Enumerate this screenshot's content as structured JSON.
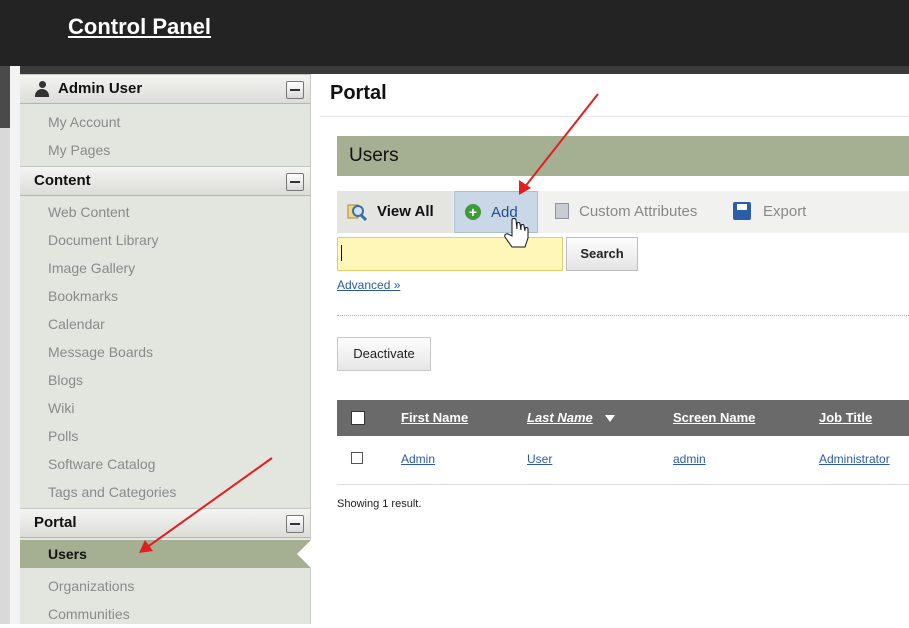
{
  "header": {
    "title": "Control Panel"
  },
  "sidebar": {
    "user_section": {
      "label": "Admin User",
      "items": [
        "My Account",
        "My Pages"
      ]
    },
    "content_section": {
      "label": "Content",
      "items": [
        "Web Content",
        "Document Library",
        "Image Gallery",
        "Bookmarks",
        "Calendar",
        "Message Boards",
        "Blogs",
        "Wiki",
        "Polls",
        "Software Catalog",
        "Tags and Categories"
      ]
    },
    "portal_section": {
      "label": "Portal",
      "items": [
        "Users",
        "Organizations",
        "Communities"
      ],
      "active_item": "Users"
    }
  },
  "main": {
    "page_title": "Portal",
    "panel_title": "Users",
    "toolbar": {
      "view_all": "View All",
      "add": "Add",
      "custom_attributes": "Custom Attributes",
      "export": "Export"
    },
    "search": {
      "value": "",
      "button": "Search",
      "advanced_link": "Advanced »"
    },
    "deactivate_button": "Deactivate",
    "table": {
      "columns": [
        "First Name",
        "Last Name",
        "Screen Name",
        "Job Title"
      ],
      "sorted_column": "Last Name",
      "rows": [
        {
          "first_name": "Admin",
          "last_name": "User",
          "screen_name": "admin",
          "job_title": "Administrator"
        }
      ]
    },
    "result_count": "Showing 1 result."
  },
  "colors": {
    "accent_green": "#a5b092",
    "top_bar": "#232323",
    "sidebar_bg": "#e3e5df",
    "search_highlight": "#fff7b8",
    "annotation_arrow": "#e02020"
  },
  "icons": {
    "user_section": "user-icon",
    "view_all": "magnifier-icon",
    "add": "plus-circle-icon",
    "custom_attributes": "document-icon",
    "export": "floppy-disk-icon",
    "collapse": "minus-icon",
    "cursor": "hand-pointer-icon"
  }
}
